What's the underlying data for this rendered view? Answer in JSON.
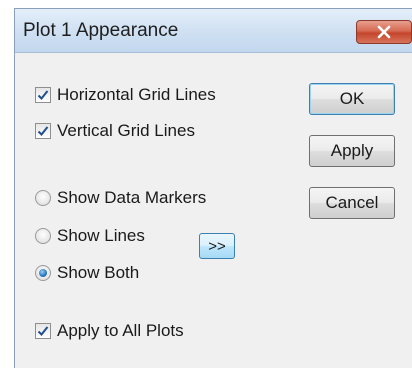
{
  "dialog": {
    "title": "Plot 1 Appearance",
    "close_icon": "close-x-icon"
  },
  "options": {
    "horizontal_grid": {
      "label": "Horizontal Grid Lines",
      "checked": true
    },
    "vertical_grid": {
      "label": "Vertical Grid Lines",
      "checked": true
    },
    "show_markers": {
      "label": "Show Data Markers",
      "selected": false
    },
    "show_lines": {
      "label": "Show Lines",
      "selected": false
    },
    "show_both": {
      "label": "Show Both",
      "selected": true
    },
    "apply_all": {
      "label": "Apply to All Plots",
      "checked": true
    }
  },
  "buttons": {
    "ok": "OK",
    "apply": "Apply",
    "cancel": "Cancel",
    "more": ">>"
  },
  "colors": {
    "close_button": "#c4452b",
    "check_mark": "#1f4e8a",
    "radio_selected": "#2a7bc4"
  }
}
